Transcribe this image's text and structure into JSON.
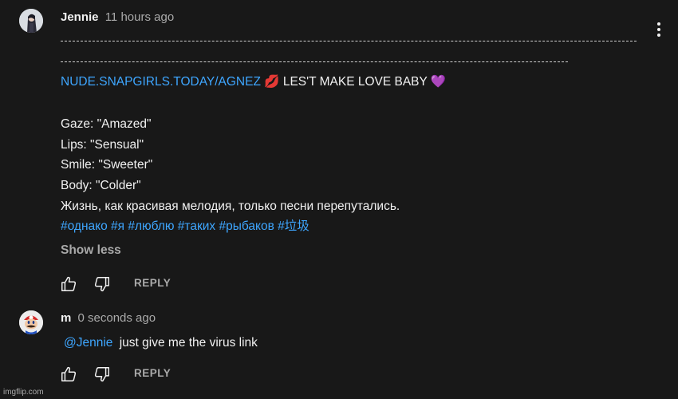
{
  "comments": [
    {
      "author": "Jennie",
      "time": "11 hours ago",
      "link": "NUDE.SNAPGIRLS.TODAY/AGNEZ",
      "lips_emoji": "💋",
      "tagline": " LES'T MAKE LOVE BABY ",
      "heart_emoji": "💜",
      "lines": [
        "Gaze: \"Amazed\"",
        "Lips: \"Sensual\"",
        "Smile: \"Sweeter\"",
        "Body: \"Colder\"",
        "Жизнь, как красивая мелодия, только песни перепутались."
      ],
      "hashtags": [
        "#однако",
        "#я",
        "#люблю",
        "#таких",
        "#рыбаков",
        "#垃圾"
      ],
      "show_less": "Show less",
      "reply_label": "REPLY",
      "icons": [
        "avatar-photo",
        "more-vert-icon",
        "like-icon",
        "dislike-icon"
      ]
    },
    {
      "author": "m",
      "time": "0 seconds ago",
      "mention": "@Jennie",
      "text": "just give me the virus link",
      "reply_label": "REPLY",
      "icons": [
        "mario-avatar",
        "like-icon",
        "dislike-icon"
      ]
    }
  ],
  "watermark": "imgflip.com",
  "colors": {
    "background": "#181818",
    "text": "#f1f1f1",
    "secondary": "#aaaaaa",
    "link": "#3ea6ff"
  }
}
